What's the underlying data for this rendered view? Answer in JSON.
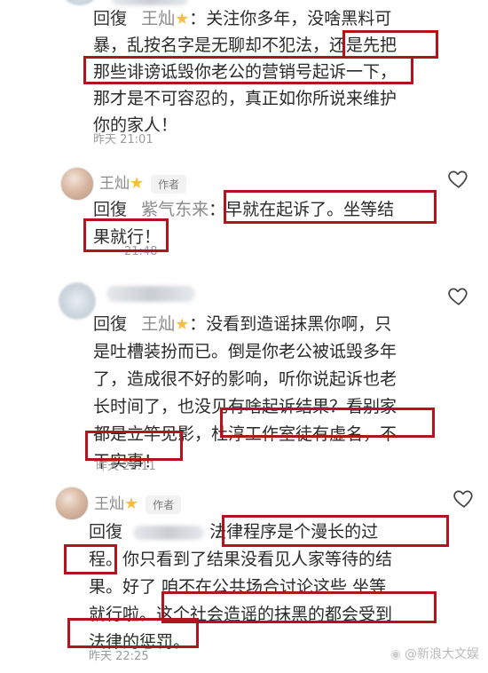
{
  "reply_prefix": "回復",
  "author_tag": "作者",
  "comments": [
    {
      "mention": "王灿",
      "lines": [
        "关注你多年，没啥黑料可",
        "暴，乱按名字是无聊却不犯法，还是先把",
        "那些诽谤诋毁你老公的营销号起诉一下，",
        "那才是不可容忍的，真正如你所说来维护",
        "你的家人！"
      ],
      "time": "昨天 21:01"
    },
    {
      "name": "王灿",
      "mention": "紫气东来",
      "lines": [
        "早就在起诉了。坐等结",
        "果就行！"
      ],
      "time": "21:48"
    },
    {
      "mention": "王灿",
      "lines": [
        "没看到造谣抹黑你啊，只",
        "是吐槽装扮而已。倒是你老公被诋毁多年",
        "了，造成很不好的影响，听你说起诉也老",
        "长时间了，也没见有啥起诉结果？看别家",
        "都是立竿见影，杜淳工作室徒有虚名，不",
        "干实事！"
      ],
      "time": "昨天 22:11"
    },
    {
      "name": "王灿",
      "lines": [
        "法律程序是个漫长的过",
        "程。你只看到了结果没看见人家等待的结",
        "果。好了 咱不在公共场合讨论这些 坐等",
        "就行啦。这个社会造谣的抹黑的都会受到",
        "法律的惩罚。"
      ],
      "time": "昨天 22:25"
    }
  ],
  "watermark": "@新浪大文娱",
  "highlight_color": "#b3121f"
}
